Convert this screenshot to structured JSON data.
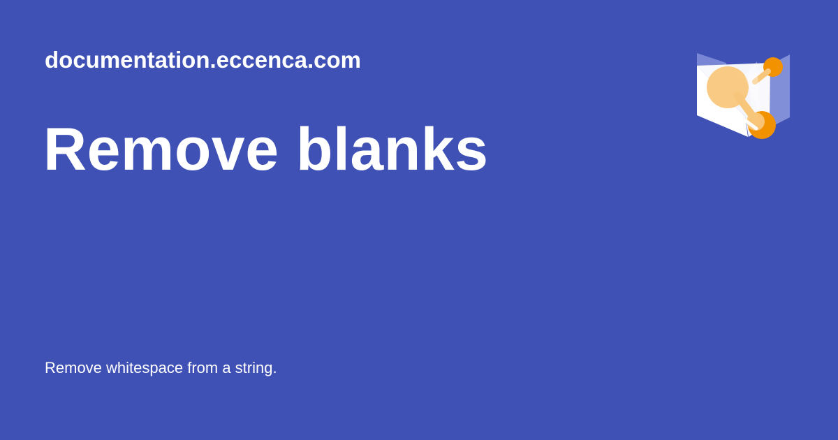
{
  "page": {
    "site_name": "documentation.eccenca.com",
    "title": "Remove blanks",
    "description": "Remove whitespace from a string."
  },
  "logo": {
    "icon": "eccenca-logo-icon"
  },
  "colors": {
    "background": "#3f51b5",
    "text": "#ffffff",
    "accent_orange": "#f39200",
    "accent_light_orange": "#f8c67a"
  }
}
